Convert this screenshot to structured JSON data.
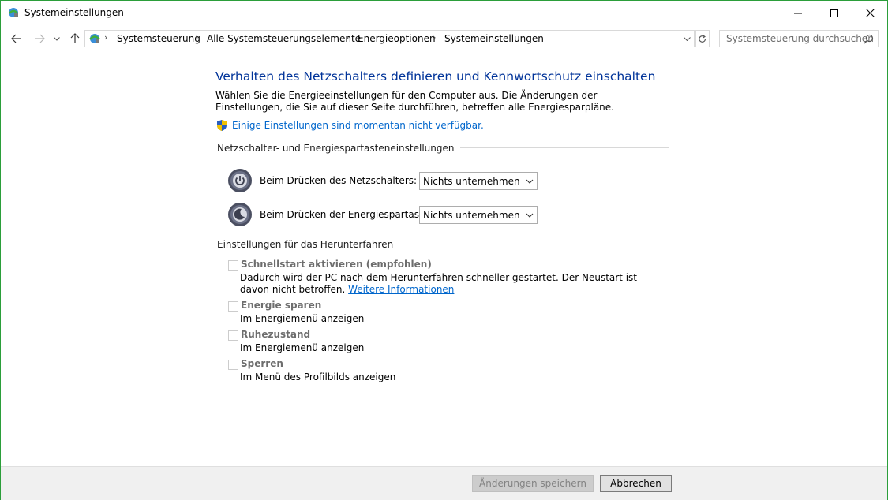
{
  "window": {
    "title": "Systemeinstellungen"
  },
  "navigation": {
    "breadcrumbs": [
      "Systemsteuerung",
      "Alle Systemsteuerungselemente",
      "Energieoptionen",
      "Systemeinstellungen"
    ],
    "breadcrumb_separator": "›",
    "search_placeholder": "Systemsteuerung durchsuchen"
  },
  "main": {
    "heading": "Verhalten des Netzschalters definieren und Kennwortschutz einschalten",
    "description": "Wählen Sie die Energieeinstellungen für den Computer aus. Die Änderungen der Einstellungen, die Sie auf dieser Seite durchführen, betreffen alle Energiesparpläne.",
    "unavailable_link": "Einige Einstellungen sind momentan nicht verfügbar.",
    "power_section": {
      "title": "Netzschalter- und Energiespartasteneinstellungen",
      "rows": [
        {
          "label": "Beim Drücken des Netzschalters:",
          "value": "Nichts unternehmen"
        },
        {
          "label": "Beim Drücken der Energiespartaste:",
          "value": "Nichts unternehmen"
        }
      ]
    },
    "shutdown_section": {
      "title": "Einstellungen für das Herunterfahren",
      "fast_startup": {
        "label": "Schnellstart aktivieren (empfohlen)",
        "desc": "Dadurch wird der PC nach dem Herunterfahren schneller gestartet. Der Neustart ist davon nicht betroffen.",
        "link": "Weitere Informationen",
        "checked": false
      },
      "sleep": {
        "label": "Energie sparen",
        "desc": "Im Energiemenü anzeigen",
        "checked": false
      },
      "hibernate": {
        "label": "Ruhezustand",
        "desc": "Im Energiemenü anzeigen",
        "checked": false
      },
      "lock": {
        "label": "Sperren",
        "desc": "Im Menü des Profilbilds anzeigen",
        "checked": false
      }
    }
  },
  "footer": {
    "save_label": "Änderungen speichern",
    "cancel_label": "Abbrechen"
  },
  "colors": {
    "window_border": "#2b9e3a",
    "heading": "#003399",
    "link": "#0066cc"
  }
}
